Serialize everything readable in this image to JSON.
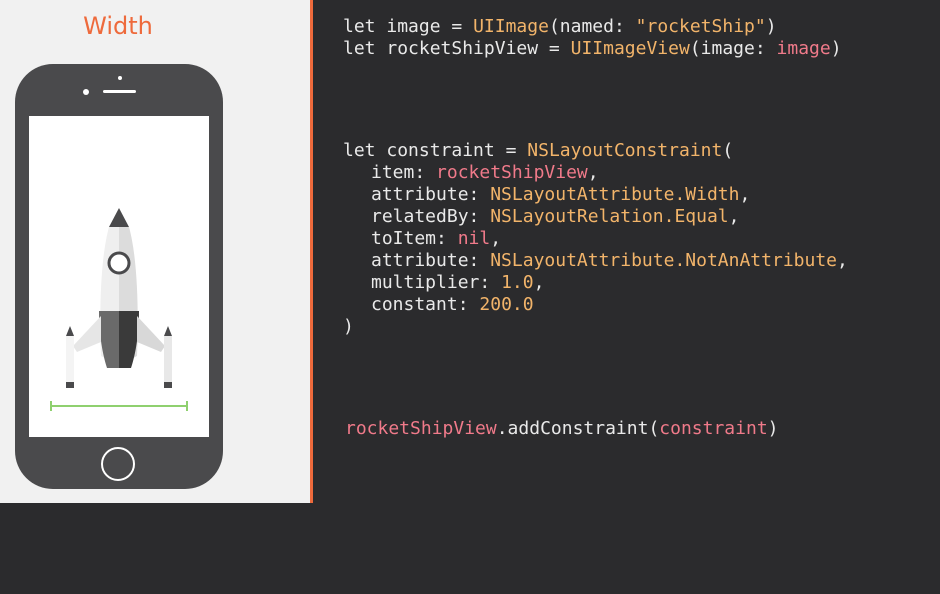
{
  "colors": {
    "accent": "#ee6a3c",
    "code_bg": "#2b2b2d",
    "keyword": "#e9e9e9",
    "type": "#f2b46a",
    "variable": "#f07a8a",
    "measure_line": "#8fd06f"
  },
  "slide": {
    "title": "Width"
  },
  "code": {
    "block1": {
      "line1": {
        "let": "let",
        "name": "image",
        "eq": "=",
        "type": "UIImage",
        "open": "(",
        "param": "named:",
        "arg": "\"rocketShip\"",
        "close": ")"
      },
      "line2": {
        "let": "let",
        "name": "rocketShipView",
        "eq": "=",
        "type": "UIImageView",
        "open": "(",
        "param": "image:",
        "arg": "image",
        "close": ")"
      }
    },
    "block2": {
      "header": {
        "let": "let",
        "name": "constraint",
        "eq": "=",
        "type": "NSLayoutConstraint",
        "open": "("
      },
      "item": {
        "label": "item:",
        "value": "rocketShipView",
        "sep": ","
      },
      "attribute1": {
        "label": "attribute:",
        "type": "NSLayoutAttribute",
        "member": ".Width",
        "sep": ","
      },
      "relatedBy": {
        "label": "relatedBy:",
        "type": "NSLayoutRelation",
        "member": ".Equal",
        "sep": ","
      },
      "toItem": {
        "label": "toItem:",
        "value": "nil",
        "sep": ","
      },
      "attribute2": {
        "label": "attribute:",
        "type": "NSLayoutAttribute",
        "member": ".NotAnAttribute",
        "sep": ","
      },
      "multiplier": {
        "label": "multiplier:",
        "value": "1.0",
        "sep": ","
      },
      "constant": {
        "label": "constant:",
        "value": "200.0"
      },
      "close": ")"
    },
    "block3": {
      "receiver": "rocketShipView",
      "method": ".addConstraint",
      "open": "(",
      "arg": "constraint",
      "close": ")"
    }
  },
  "icons": [
    "rocket-icon",
    "phone-icon",
    "home-button-icon"
  ]
}
